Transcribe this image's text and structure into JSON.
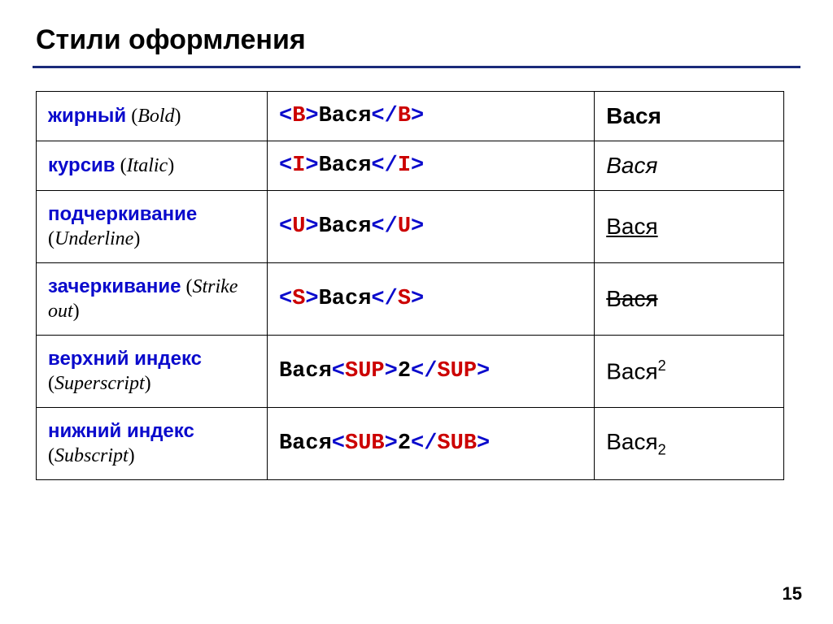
{
  "title": "Стили оформления",
  "page_number": "15",
  "sample_word": "Вася",
  "sample_digit": "2",
  "angle_open": "<",
  "angle_close": ">",
  "slash": "/",
  "rows": [
    {
      "ru": "жирный",
      "en": "Bold",
      "tag": "B",
      "code_inner": "Вася",
      "render_style": "bold",
      "has_script": false
    },
    {
      "ru": "курсив",
      "en": "Italic",
      "tag": "I",
      "code_inner": "Вася",
      "render_style": "italic",
      "has_script": false
    },
    {
      "ru": "подчеркивание",
      "en": "Underline",
      "tag": "U",
      "code_inner": "Вася",
      "render_style": "underline",
      "has_script": false
    },
    {
      "ru": "зачеркивание",
      "en": "Strike out",
      "tag": "S",
      "code_inner": "Вася",
      "render_style": "strike",
      "has_script": false
    },
    {
      "ru": "верхний индекс",
      "en": "Superscript",
      "tag": "SUP",
      "code_prefix": "Вася",
      "code_inner": "2",
      "render_style": "sup",
      "has_script": true
    },
    {
      "ru": "нижний индекс",
      "en": "Subscript",
      "tag": "SUB",
      "code_prefix": "Вася",
      "code_inner": "2",
      "render_style": "sub",
      "has_script": true
    }
  ]
}
